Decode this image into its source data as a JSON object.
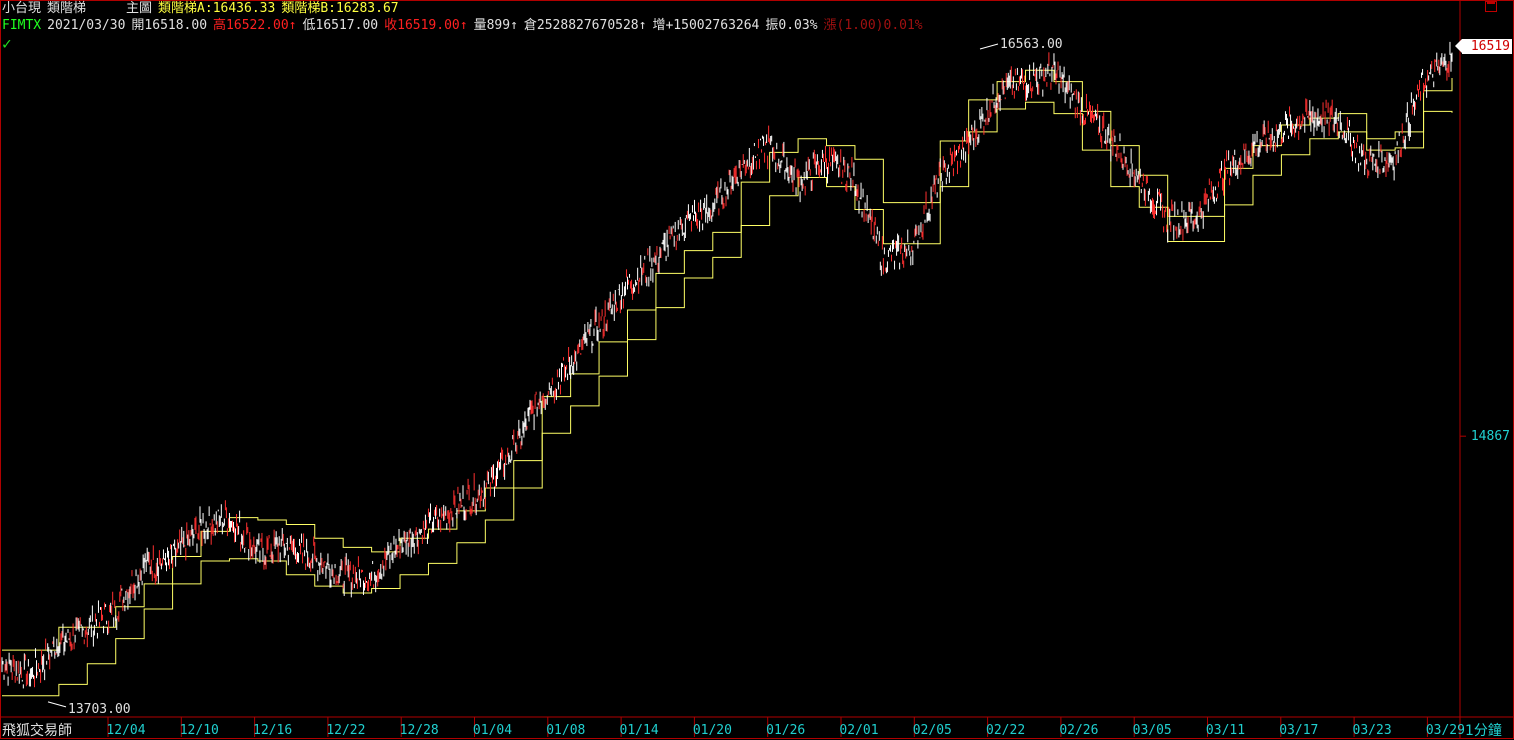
{
  "header": {
    "instrument": "小台現",
    "indicator": "類階梯",
    "main": "主圖",
    "ladder_a": "類階梯A:16436.33",
    "ladder_b": "類階梯B:16283.67",
    "code": "FIMTX",
    "date": "2021/03/30",
    "open": "開16518.00",
    "high": "高16522.00",
    "low": "低16517.00",
    "close": "收16519.00",
    "volume": "量899",
    "open_interest": "倉2528827670528",
    "increase": "增+15002763264",
    "amplitude": "振0.03%",
    "change": "漲(1.00)0.01%"
  },
  "footer": {
    "brand": "飛狐交易師",
    "timeframe": "1分鐘"
  },
  "chart_data": {
    "type": "line",
    "ylim": [
      13650,
      16620
    ],
    "y_ticks": [
      14867
    ],
    "x_tick_labels": [
      "12/04",
      "12/10",
      "12/16",
      "12/22",
      "12/28",
      "01/04",
      "01/08",
      "01/14",
      "01/20",
      "01/26",
      "02/01",
      "02/05",
      "02/22",
      "02/26",
      "03/05",
      "03/11",
      "03/17",
      "03/23",
      "03/29"
    ],
    "last_price": "16519",
    "max_label": "16563.00",
    "min_label": "13703.00",
    "max_value": 16563,
    "min_value": 13703,
    "series": [
      {
        "name": "類階梯A",
        "color": "#ffff66",
        "values": [
          13930,
          13930,
          14030,
          14030,
          14120,
          14220,
          14340,
          14450,
          14510,
          14500,
          14480,
          14420,
          14380,
          14360,
          14420,
          14460,
          14540,
          14640,
          14760,
          15040,
          15140,
          15280,
          15420,
          15580,
          15680,
          15760,
          15980,
          16110,
          16170,
          16140,
          16080,
          15890,
          15890,
          16160,
          16340,
          16420,
          16470,
          16420,
          16290,
          16140,
          16010,
          15830,
          15830,
          16040,
          16140,
          16230,
          16260,
          16280,
          16170,
          16200,
          16380,
          16436
        ]
      },
      {
        "name": "類階梯B",
        "color": "#ffff66",
        "values": [
          13730,
          13730,
          13780,
          13870,
          13980,
          14110,
          14220,
          14320,
          14330,
          14320,
          14260,
          14210,
          14180,
          14200,
          14260,
          14310,
          14400,
          14500,
          14640,
          14880,
          15000,
          15130,
          15290,
          15430,
          15560,
          15650,
          15790,
          15920,
          16000,
          15960,
          15860,
          15710,
          15710,
          15960,
          16200,
          16300,
          16330,
          16280,
          16120,
          15960,
          15870,
          15720,
          15720,
          15880,
          16010,
          16100,
          16170,
          16200,
          16120,
          16130,
          16290,
          16284
        ]
      },
      {
        "name": "price",
        "color": "#ffffff",
        "values": [
          13870,
          13820,
          13960,
          14020,
          14110,
          14300,
          14330,
          14470,
          14510,
          14360,
          14390,
          14330,
          14260,
          14250,
          14400,
          14470,
          14560,
          14640,
          14810,
          15050,
          15180,
          15350,
          15530,
          15640,
          15800,
          15860,
          16050,
          16140,
          15980,
          16080,
          15990,
          15640,
          15690,
          16000,
          16150,
          16370,
          16420,
          16460,
          16300,
          16170,
          16000,
          15810,
          15830,
          16020,
          16130,
          16200,
          16270,
          16250,
          16060,
          16090,
          16420,
          16519
        ]
      }
    ]
  }
}
